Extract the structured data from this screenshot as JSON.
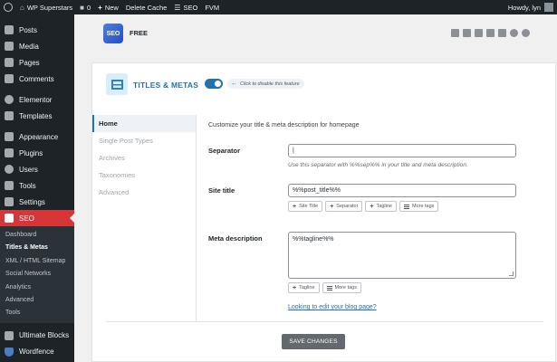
{
  "adminbar": {
    "site_name": "WP Superstars",
    "comments_count": "0",
    "new_label": "New",
    "delete_cache": "Delete Cache",
    "seo_label": "SEO",
    "fvm_label": "FVM",
    "howdy": "Howdy, lyn"
  },
  "sidebar": {
    "items": [
      {
        "label": "Posts",
        "icon": "pushpin-icon"
      },
      {
        "label": "Media",
        "icon": "media-icon"
      },
      {
        "label": "Pages",
        "icon": "pages-icon"
      },
      {
        "label": "Comments",
        "icon": "comments-icon"
      },
      {
        "label": "Elementor",
        "icon": "elementor-icon"
      },
      {
        "label": "Templates",
        "icon": "folder-icon"
      },
      {
        "label": "Appearance",
        "icon": "brush-icon"
      },
      {
        "label": "Plugins",
        "icon": "plug-icon"
      },
      {
        "label": "Users",
        "icon": "user-icon"
      },
      {
        "label": "Tools",
        "icon": "wrench-icon"
      },
      {
        "label": "Settings",
        "icon": "settings-icon"
      },
      {
        "label": "SEO",
        "icon": "seo-icon"
      }
    ],
    "submenu": [
      "Dashboard",
      "Titles & Metas",
      "XML / HTML Sitemap",
      "Social Networks",
      "Analytics",
      "Advanced",
      "Tools"
    ],
    "bottom": [
      {
        "label": "Ultimate Blocks",
        "icon": "blocks-icon"
      },
      {
        "label": "Wordfence",
        "icon": "shield-icon"
      }
    ]
  },
  "header": {
    "logo_text": "SEO",
    "plan": "FREE"
  },
  "feature": {
    "title": "TITLES & METAS",
    "toggle_hint": "Click to disable this feature",
    "enabled": true
  },
  "tabs": [
    "Home",
    "Single Post Types",
    "Archives",
    "Taxonomies",
    "Advanced"
  ],
  "form": {
    "description": "Customize your title & meta description for homepage",
    "separator": {
      "label": "Separator",
      "value": "|",
      "note": "Use this separator with %%sep%% in your title and meta description."
    },
    "site_title": {
      "label": "Site title",
      "value": "%%post_title%%",
      "buttons": [
        "Site Title",
        "Separator",
        "Tagline",
        "More tags"
      ]
    },
    "meta_description": {
      "label": "Meta description",
      "value": "%%tagline%%",
      "buttons": [
        "Tagline",
        "More tags"
      ]
    },
    "blog_link": "Looking to edit your blog page?",
    "save_label": "SAVE CHANGES"
  },
  "colors": {
    "accent": "#2271b1",
    "seo_active": "#d63638",
    "sidebar_bg": "#1d2327"
  }
}
